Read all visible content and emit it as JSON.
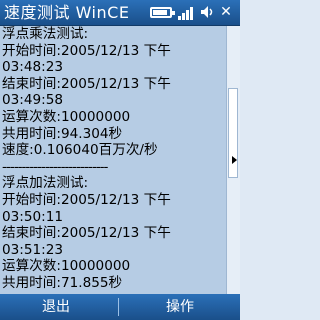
{
  "window": {
    "title": "速度测试 WinCE"
  },
  "status": {
    "icons": [
      "battery-icon",
      "signal-icon",
      "volume-icon",
      "close-icon"
    ],
    "close_label": "✕"
  },
  "content": {
    "lines": [
      "浮点乘法测试:",
      "开始时间:2005/12/13 下午",
      "03:48:23",
      "结束时间:2005/12/13 下午",
      "03:49:58",
      "运算次数:10000000",
      "共用时间:94.304秒",
      "速度:0.106040百万次/秒",
      "---------------------------",
      "浮点加法测试:",
      "开始时间:2005/12/13 下午",
      "03:50:11",
      "结束时间:2005/12/13 下午",
      "03:51:23",
      "运算次数:10000000",
      "共用时间:71.855秒"
    ]
  },
  "softkeys": {
    "left": "退出",
    "right": "操作"
  },
  "colors": {
    "titlebar": "#2b70b8",
    "content_bg": "#b6cce4"
  }
}
